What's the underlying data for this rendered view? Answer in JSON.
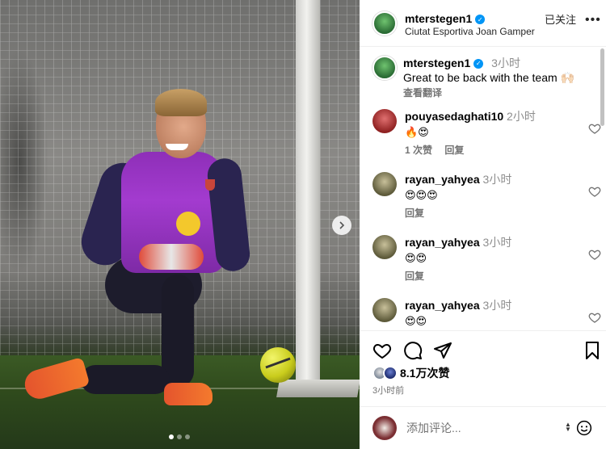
{
  "post": {
    "username": "mterstegen1",
    "location": "Ciutat Esportiva Joan Gamper",
    "follow_label": "已关注",
    "more_label": "•••",
    "caption": {
      "username": "mterstegen1",
      "time": "3小时",
      "text": "Great to be back with the team 🙌🏻",
      "translate": "查看翻译"
    },
    "comments": [
      {
        "username": "pouyasedaghati10",
        "time": "2小时",
        "text": "🔥😍",
        "likes": "1 次赞",
        "reply": "回复"
      },
      {
        "username": "rayan_yahyea",
        "time": "3小时",
        "text": "😍😍😍",
        "likes": "",
        "reply": "回复"
      },
      {
        "username": "rayan_yahyea",
        "time": "3小时",
        "text": "😍😍",
        "likes": "",
        "reply": "回复"
      },
      {
        "username": "rayan_yahyea",
        "time": "3小时",
        "text": "😍😍",
        "likes": "",
        "reply": ""
      }
    ],
    "like_count": "8.1万次赞",
    "posted": "3小时前",
    "composer_placeholder": "添加评论...",
    "carousel": {
      "current": 1,
      "total": 3
    }
  },
  "icons": {
    "like": "heart-icon",
    "comment": "comment-icon",
    "share": "share-icon",
    "save": "bookmark-icon",
    "emoji": "emoji-icon",
    "next": "chevron-right-icon"
  },
  "colors": {
    "verified": "#0095f6",
    "muted": "#737373"
  }
}
